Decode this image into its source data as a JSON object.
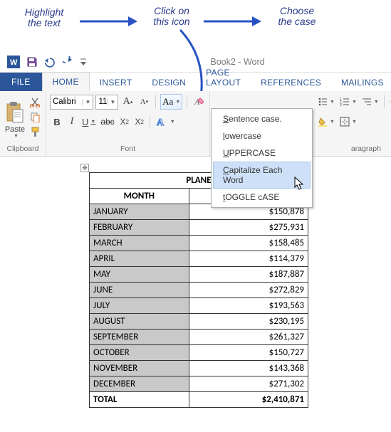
{
  "annotations": {
    "step1": "Highlight\nthe text",
    "step2": "Click on\nthis icon",
    "step3": "Choose\nthe case"
  },
  "qat": {
    "title": "Book2 - Word"
  },
  "tabs": {
    "file": "FILE",
    "home": "HOME",
    "insert": "INSERT",
    "design": "DESIGN",
    "page_layout": "PAGE LAYOUT",
    "references": "REFERENCES",
    "mailings": "MAILINGS"
  },
  "ribbon": {
    "clipboard_label": "Clipboard",
    "paste_label": "Paste",
    "font_label": "Font",
    "font_name": "Calibri",
    "font_size": "11",
    "change_case_glyph": "Aa",
    "paragraph_label": "aragraph"
  },
  "case_menu": {
    "sentence": "entence case.",
    "sentence_m": "S",
    "lower": "owercase",
    "lower_m": "l",
    "upper": "PPERCASE",
    "upper_m": "U",
    "cap": "apitalize Each Word",
    "cap_m": "C",
    "toggle": "OGGLE cASE",
    "toggle_m": "t"
  },
  "table": {
    "title": "PLANE",
    "col_month": "MONTH",
    "rows": [
      {
        "m": "JANUARY",
        "v": "$150,878"
      },
      {
        "m": "FEBRUARY",
        "v": "$275,931"
      },
      {
        "m": "MARCH",
        "v": "$158,485"
      },
      {
        "m": "APRIL",
        "v": "$114,379"
      },
      {
        "m": "MAY",
        "v": "$187,887"
      },
      {
        "m": "JUNE",
        "v": "$272,829"
      },
      {
        "m": "JULY",
        "v": "$193,563"
      },
      {
        "m": "AUGUST",
        "v": "$230,195"
      },
      {
        "m": "SEPTEMBER",
        "v": "$261,327"
      },
      {
        "m": "OCTOBER",
        "v": "$150,727"
      },
      {
        "m": "NOVEMBER",
        "v": "$143,368"
      },
      {
        "m": "DECEMBER",
        "v": "$271,302"
      }
    ],
    "total_label": "TOTAL",
    "total_value": "$2,410,871"
  }
}
